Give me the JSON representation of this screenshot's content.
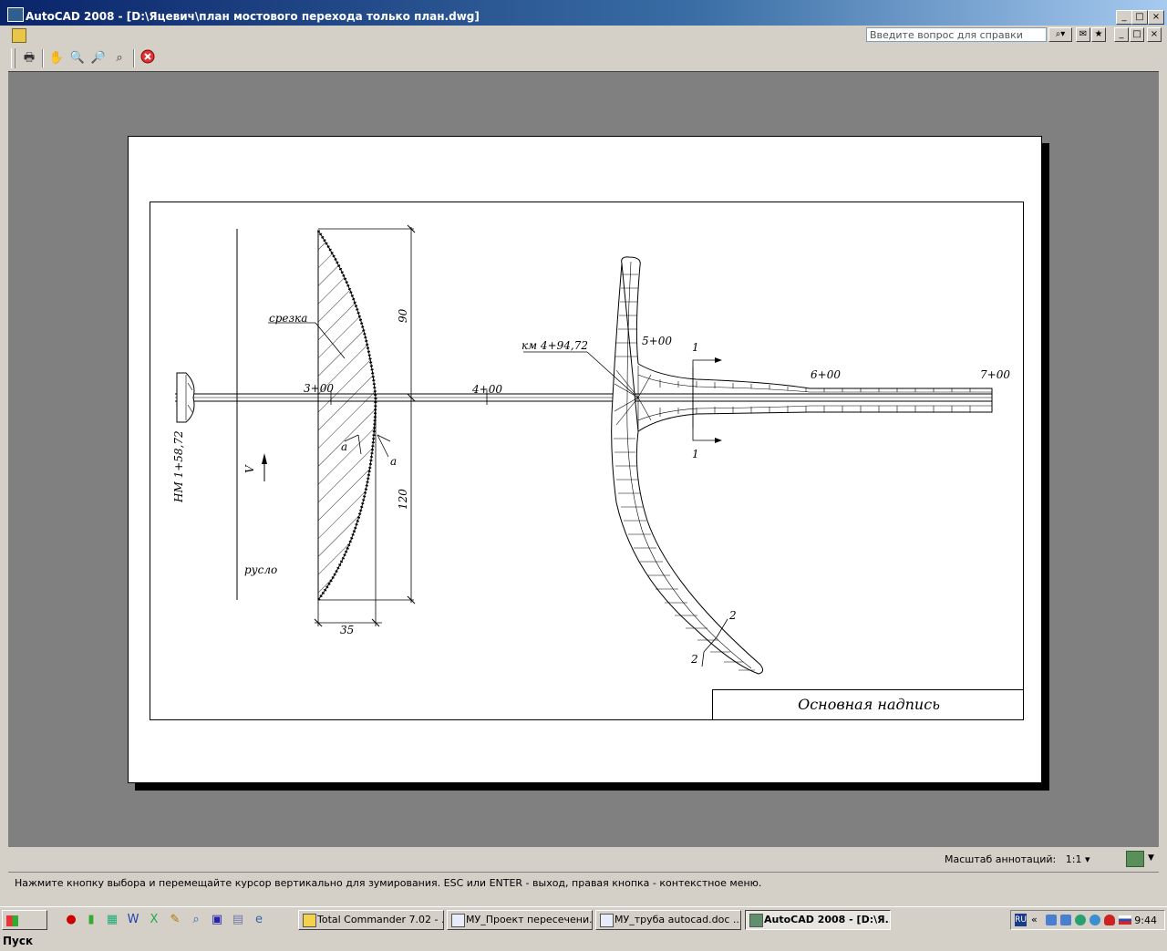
{
  "window": {
    "title": "AutoCAD 2008 - [D:\\Яцевич\\план мостового перехода только план.dwg]",
    "controls": [
      "_",
      "□",
      "×"
    ]
  },
  "menubar": {
    "help_placeholder": "Введите вопрос для справки",
    "doc_controls": [
      "_",
      "□",
      "×"
    ]
  },
  "toolbar": {
    "icons": [
      "plot-icon",
      "pan-icon",
      "zoom-realtime-icon",
      "zoom-window-icon",
      "zoom-previous-icon",
      "close-preview-icon"
    ]
  },
  "drawing": {
    "labels": {
      "srezka": "срезка",
      "km": "км 4+94,72",
      "nm": "НМ 1+58,72",
      "v": "V",
      "ruslo": "русло",
      "dim_90": "90",
      "dim_120": "120",
      "dim_35": "35",
      "a1": "a",
      "a2": "a",
      "sec1_top": "1",
      "sec1_bottom": "1",
      "sec2_top": "2",
      "sec2_bottom": "2"
    },
    "stations": [
      "3+00",
      "4+00",
      "5+00",
      "6+00",
      "7+00"
    ],
    "title_block": "Основная надпись"
  },
  "status": {
    "annotation_scale_label": "Масштаб аннотаций:",
    "annotation_scale_value": "1:1 ▾"
  },
  "command_line": "Нажмите кнопку выбора и перемещайте курсор вертикально для зумирования. ESC или ENTER - выход, правая кнопка - контекстное меню.",
  "taskbar": {
    "start": "Пуск",
    "tasks": [
      {
        "label": "Total Commander 7.02 - ...",
        "active": false
      },
      {
        "label": "МУ_Проект пересечени...",
        "active": false
      },
      {
        "label": "МУ_труба autocad.doc ...",
        "active": false
      },
      {
        "label": "AutoCAD 2008 - [D:\\Я...",
        "active": true
      }
    ],
    "tray_lang": "RU",
    "clock": "9:44",
    "tray_chevron": "«"
  }
}
